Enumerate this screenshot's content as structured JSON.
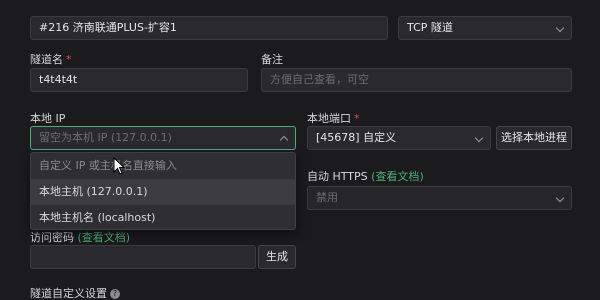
{
  "top": {
    "tunnel_node": "#216 济南联通PLUS-扩容1",
    "protocol": "TCP 隧道"
  },
  "tunnel_name": {
    "label": "隧道名",
    "required_mark": "*",
    "value": "t4t4t4t"
  },
  "remark": {
    "label": "备注",
    "placeholder": "方便自己查看，可空"
  },
  "local_ip": {
    "label": "本地 IP",
    "placeholder": "留空为本机 IP (127.0.0.1)",
    "dropdown": {
      "hint": "自定义 IP 或主机名直接输入",
      "options": [
        "本地主机 (127.0.0.1)",
        "本地主机名 (localhost)"
      ]
    }
  },
  "local_port": {
    "label": "本地端口",
    "required_mark": "*",
    "value": "[45678] 自定义",
    "button": "选择本地进程"
  },
  "auto_https": {
    "label": "自动 HTTPS",
    "link_open": "(",
    "link": "查看文档",
    "link_close": ")",
    "value": "禁用"
  },
  "access_key": {
    "label": "访问密码",
    "link_open": "(",
    "link": "查看文档",
    "link_close": ")",
    "button": "生成"
  },
  "custom_settings": {
    "label": "隧道自定义设置",
    "help_icon": "?"
  },
  "colors": {
    "accent": "#4caf72",
    "required": "#e5484d",
    "background": "#1b1b1e"
  }
}
